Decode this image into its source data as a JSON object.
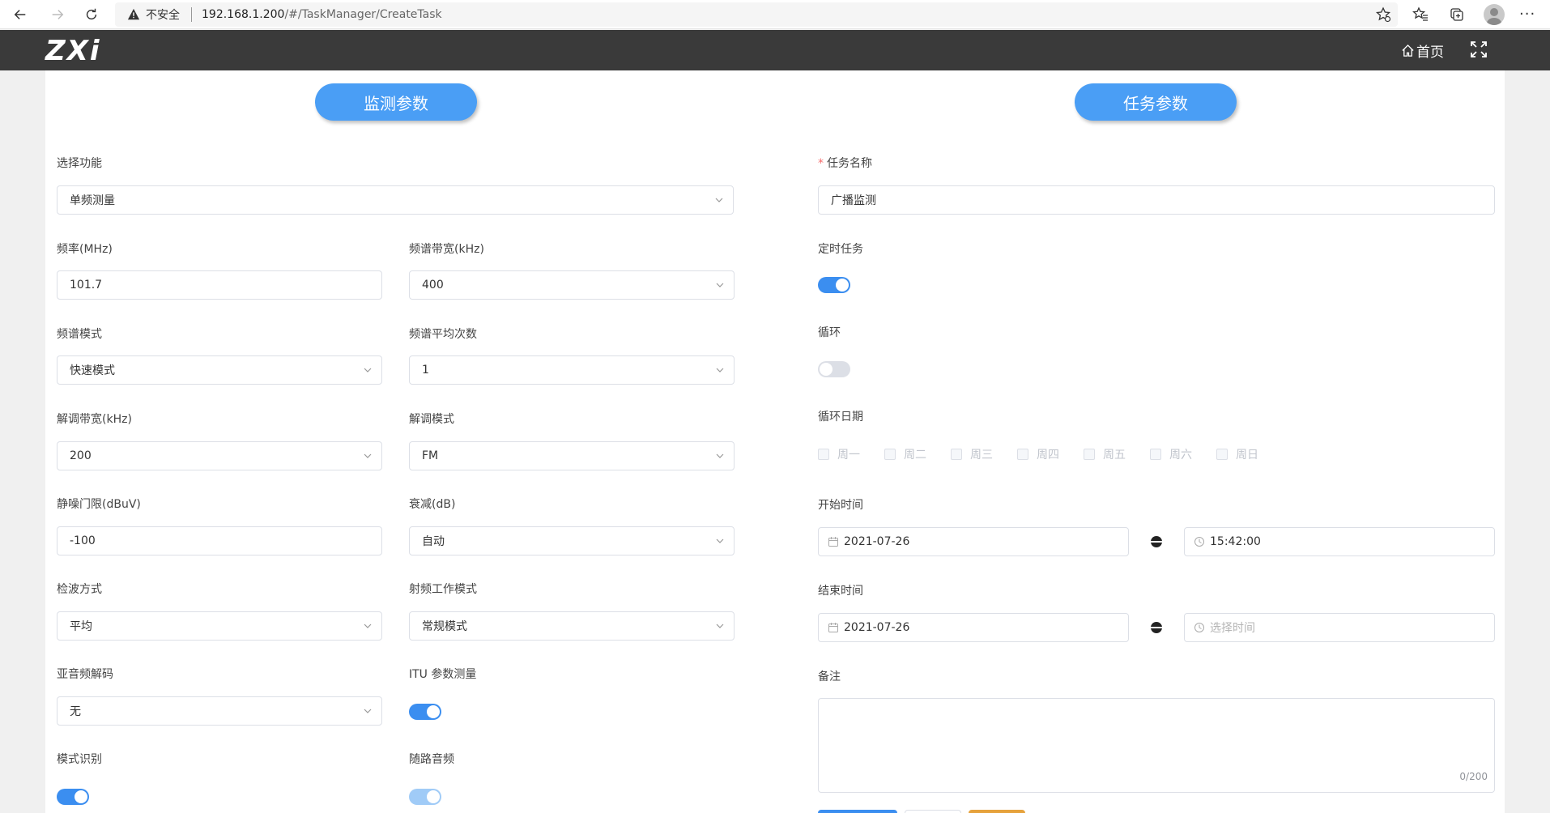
{
  "browser": {
    "insecure_label": "不安全",
    "url_host": "192.168.1.200",
    "url_path": "/#/TaskManager/CreateTask"
  },
  "header": {
    "logo": "ZXi",
    "home": "首页"
  },
  "monitor": {
    "title": "监测参数",
    "function_label": "选择功能",
    "function_value": "单频测量",
    "freq_label": "频率(MHz)",
    "freq_value": "101.7",
    "span_label": "频谱带宽(kHz)",
    "span_value": "400",
    "spec_mode_label": "频谱模式",
    "spec_mode_value": "快速模式",
    "avg_label": "频谱平均次数",
    "avg_value": "1",
    "demod_bw_label": "解调带宽(kHz)",
    "demod_bw_value": "200",
    "demod_mode_label": "解调模式",
    "demod_mode_value": "FM",
    "squelch_label": "静噪门限(dBuV)",
    "squelch_value": "-100",
    "atten_label": "衰减(dB)",
    "atten_value": "自动",
    "detector_label": "检波方式",
    "detector_value": "平均",
    "rf_mode_label": "射频工作模式",
    "rf_mode_value": "常规模式",
    "subaudio_label": "亚音频解码",
    "subaudio_value": "无",
    "itu_label": "ITU 参数测量",
    "itu_on": true,
    "recog_label": "模式识别",
    "recog_on": true,
    "audio_label": "随路音频",
    "audio_on": true
  },
  "task": {
    "title": "任务参数",
    "name_label": "任务名称",
    "name_value": "广播监测",
    "timed_label": "定时任务",
    "timed_on": true,
    "loop_label": "循环",
    "loop_on": false,
    "loop_date_label": "循环日期",
    "weekdays": [
      "周一",
      "周二",
      "周三",
      "周四",
      "周五",
      "周六",
      "周日"
    ],
    "start_label": "开始时间",
    "start_date": "2021-07-26",
    "start_time": "15:42:00",
    "end_label": "结束时间",
    "end_date": "2021-07-26",
    "end_time_placeholder": "选择时间",
    "remark_label": "备注",
    "remark_counter": "0/200"
  },
  "colors": {
    "accent": "#4a9ef5",
    "switch_on": "#3b8ef0",
    "header_bg": "#3a3a3a"
  }
}
